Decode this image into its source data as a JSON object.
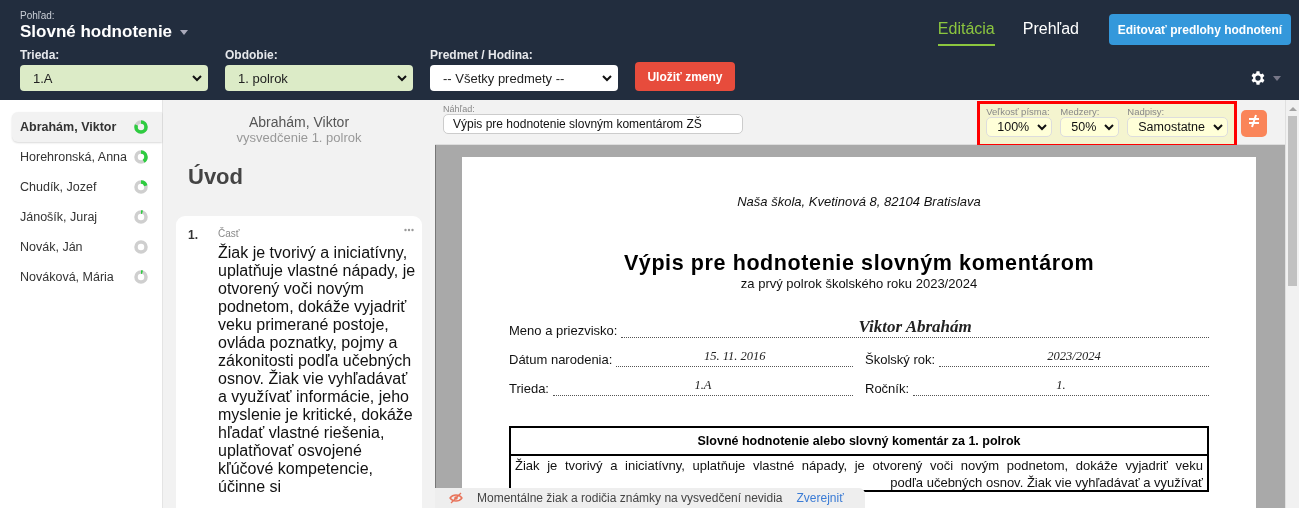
{
  "header": {
    "view_label": "Pohľad:",
    "view_title": "Slovné hodnotenie",
    "tabs": [
      {
        "label": "Editácia",
        "selected": true
      },
      {
        "label": "Prehľad",
        "selected": false
      }
    ],
    "edit_templates_button": "Editovať predlohy hodnotení"
  },
  "filters": [
    {
      "label": "Trieda:",
      "value": "1.A",
      "highlighted": true
    },
    {
      "label": "Obdobie:",
      "value": "1. polrok",
      "highlighted": true
    },
    {
      "label": "Predmet / Hodina:",
      "value": "-- Všetky predmety --",
      "highlighted": false
    }
  ],
  "save_button": "Uložiť zmeny",
  "students": [
    {
      "name": "Abrahám, Viktor",
      "selected": true,
      "level": 0.8
    },
    {
      "name": "Horehronská, Anna",
      "selected": false,
      "level": 0.4
    },
    {
      "name": "Chudík, Jozef",
      "selected": false,
      "level": 0.2
    },
    {
      "name": "Jánošík, Juraj",
      "selected": false,
      "level": 0.05
    },
    {
      "name": "Novák, Ján",
      "selected": false,
      "level": 0
    },
    {
      "name": "Nováková, Mária",
      "selected": false,
      "level": 0.05
    }
  ],
  "editor": {
    "student": "Abrahám, Viktor",
    "subtitle": "vysvedčenie 1. polrok",
    "section_title": "Úvod",
    "parts": [
      {
        "number": "1.",
        "label": "Časť",
        "text": "Žiak je tvorivý a iniciatívny, uplatňuje vlastné nápady, je otvorený voči novým podnetom, dokáže vyjadriť veku primerané postoje, ovláda poznatky, pojmy a zákonitosti podľa učebných osnov. Žiak vie vyhľadávať a využívať informácie, jeho myslenie je kritické, dokáže hľadať vlastné riešenia, uplatňovať osvojené kľúčové kompetencie, účinne si"
      }
    ]
  },
  "preview": {
    "label": "Náhľad:",
    "template": "Výpis pre hodnotenie slovným komentárom ZŠ",
    "options": [
      {
        "label": "Veľkosť písma:",
        "value": "100%"
      },
      {
        "label": "Medzery:",
        "value": "50%"
      },
      {
        "label": "Nadpisy:",
        "value": "Samostatne"
      }
    ],
    "document": {
      "school": "Naša škola, Kvetinová 8, 82104 Bratislava",
      "title": "Výpis pre hodnotenie slovným komentárom",
      "subtitle": "za prvý polrok školského roku 2023/2024",
      "field_rows": [
        {
          "fields": [
            {
              "label": "Meno a priezvisko:",
              "value": "Viktor Abrahám",
              "kind": "name"
            }
          ]
        },
        {
          "fields": [
            {
              "label": "Dátum narodenia:",
              "value": "15. 11. 2016",
              "kind": "plain"
            },
            {
              "label": "Školský rok:",
              "value": "2023/2024",
              "kind": "plain"
            }
          ]
        },
        {
          "fields": [
            {
              "label": "Trieda:",
              "value": "1.A",
              "kind": "plain"
            },
            {
              "label": "Ročník:",
              "value": "1.",
              "kind": "plain"
            }
          ]
        }
      ],
      "table_heading": "Slovné hodnotenie alebo slovný komentár za 1. polrok",
      "table_lines": [
        "Žiak je tvorivý a iniciatívny, uplatňuje vlastné nápady, je otvorený voči novým podnetom, dokáže vyjadriť veku",
        "podľa učebných osnov. Žiak vie vyhľadávať a využívať"
      ]
    }
  },
  "notice": {
    "text": "Momentálne žiak a rodičia známky na vysvedčení nevidia",
    "link": "Zverejniť"
  }
}
